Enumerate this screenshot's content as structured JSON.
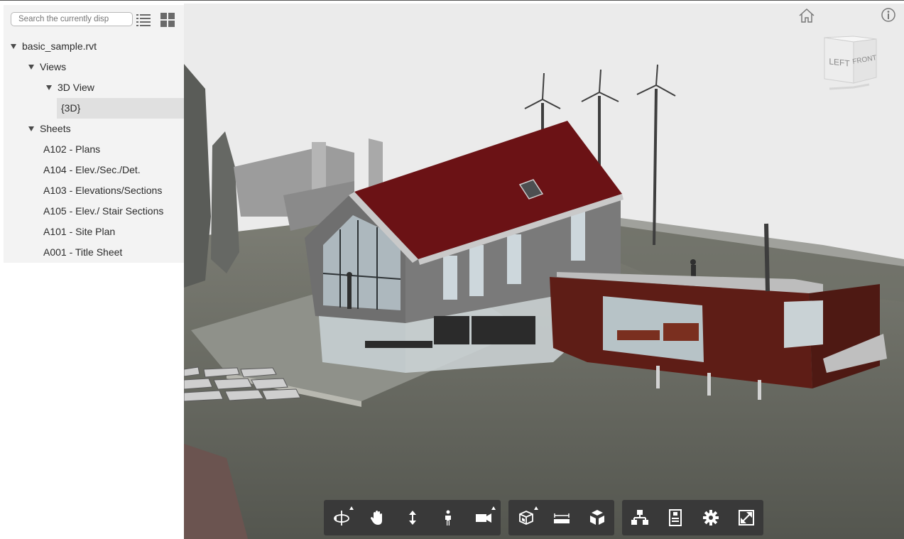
{
  "search": {
    "placeholder": "Search the currently disp"
  },
  "panel_controls": {
    "list_view_icon": "list-icon",
    "grid_view_icon": "grid-icon"
  },
  "tree": {
    "root": "basic_sample.rvt",
    "views": "Views",
    "view_3d": "3D View",
    "view_3d_item": "{3D}",
    "sheets": "Sheets",
    "sheet_items": [
      "A102 - Plans",
      "A104 - Elev./Sec./Det.",
      "A103 - Elevations/Sections",
      "A105 - Elev./ Stair Sections",
      "A101 - Site Plan",
      "A001 - Title Sheet"
    ]
  },
  "viewcube": {
    "left_face": "LEFT",
    "front_face": "FRONT"
  },
  "toolbar": {
    "navigation": [
      "orbit-icon",
      "pan-icon",
      "zoom-icon",
      "first-person-icon",
      "camera-icon"
    ],
    "model": [
      "section-analysis-icon",
      "measure-icon",
      "explode-model-icon"
    ],
    "settings": [
      "model-browser-icon",
      "properties-icon",
      "settings-icon",
      "fullscreen-icon"
    ]
  },
  "colors": {
    "roof": "#6b1215",
    "annex": "#5e1d16",
    "ground": "#5c5e56",
    "sky": "#ececec",
    "toolbar": "#393939"
  }
}
